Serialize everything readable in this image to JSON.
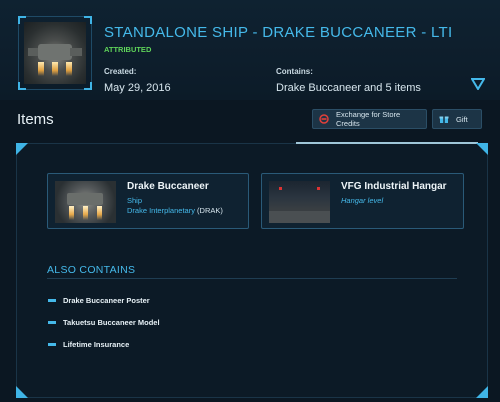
{
  "header": {
    "title": "STANDALONE SHIP - DRAKE BUCCANEER - LTI",
    "badge": "ATTRIBUTED",
    "created_label": "Created:",
    "created_value": "May 29, 2016",
    "contains_label": "Contains:",
    "contains_value": "Drake Buccaneer and 5 items",
    "expand_icon": "triangle-down-icon"
  },
  "items_section": {
    "title": "Items",
    "exchange_label": "Exchange for Store Credits",
    "gift_label": "Gift",
    "cards": [
      {
        "name": "Drake Buccaneer",
        "type": "Ship",
        "manufacturer": "Drake Interplanetary",
        "manufacturer_code": "(DRAK)"
      },
      {
        "name": "VFG Industrial Hangar",
        "type": "Hangar level"
      }
    ]
  },
  "also_contains": {
    "title": "ALSO CONTAINS",
    "items": [
      "Drake Buccaneer Poster",
      "Takuetsu Buccaneer Model",
      "Lifetime Insurance"
    ]
  },
  "colors": {
    "accent": "#45b9ea",
    "badge": "#5fd45a",
    "background": "#0b1722"
  }
}
